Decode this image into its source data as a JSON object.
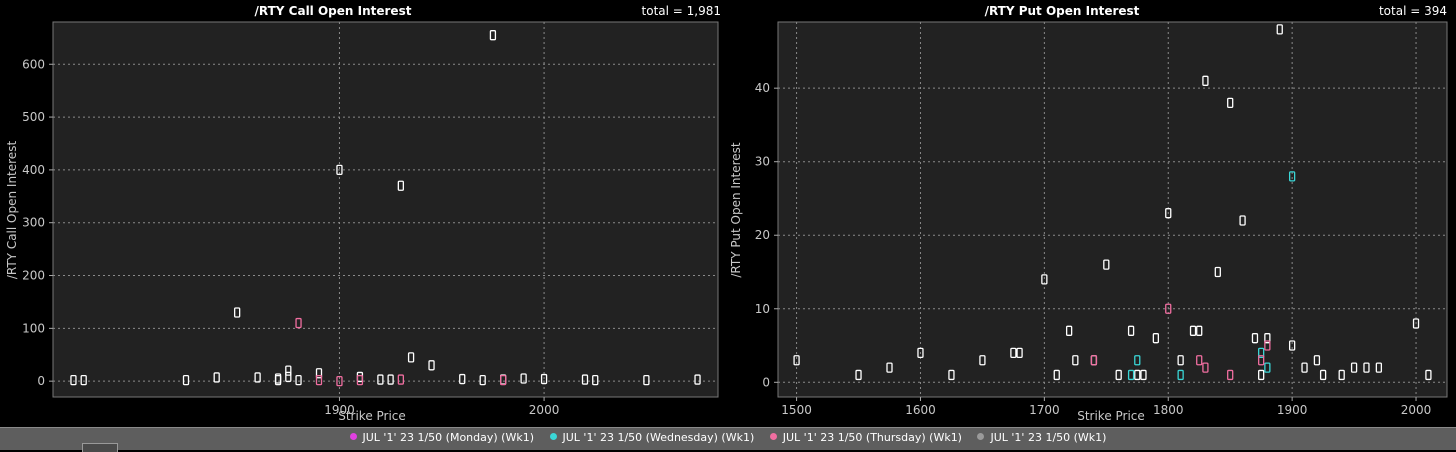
{
  "legend": [
    {
      "label": "JUL '1' 23 1/50 (Monday) (Wk1)",
      "color": "#e040e0"
    },
    {
      "label": "JUL '1' 23 1/50 (Wednesday) (Wk1)",
      "color": "#3ad6d6"
    },
    {
      "label": "JUL '1' 23 1/50 (Thursday) (Wk1)",
      "color": "#f06ea0"
    },
    {
      "label": "JUL '1' 23 1/50 (Wk1)",
      "color": "#9a9a9a"
    }
  ],
  "chart_data": [
    {
      "type": "scatter",
      "title": "/RTY Call Open Interest",
      "total_text": "total = 1,981",
      "xlabel": "Strike Price",
      "ylabel": "/RTY Call Open Interest",
      "xlim": [
        1760,
        2085
      ],
      "ylim": [
        -30,
        680
      ],
      "xticks": [
        1900,
        2000
      ],
      "yticks": [
        0,
        100,
        200,
        300,
        400,
        500,
        600
      ],
      "grid": true,
      "series": [
        {
          "color": "#ffffff",
          "points": [
            [
              1770,
              2
            ],
            [
              1775,
              2
            ],
            [
              1825,
              2
            ],
            [
              1840,
              7
            ],
            [
              1850,
              130
            ],
            [
              1860,
              7
            ],
            [
              1870,
              5
            ],
            [
              1870,
              2
            ],
            [
              1875,
              20
            ],
            [
              1875,
              8
            ],
            [
              1880,
              2
            ],
            [
              1890,
              15
            ],
            [
              1900,
              400
            ],
            [
              1910,
              8
            ],
            [
              1920,
              3
            ],
            [
              1925,
              3
            ],
            [
              1930,
              370
            ],
            [
              1935,
              45
            ],
            [
              1945,
              30
            ],
            [
              1960,
              4
            ],
            [
              1970,
              2
            ],
            [
              1975,
              655
            ],
            [
              1980,
              3
            ],
            [
              1990,
              5
            ],
            [
              2000,
              4
            ],
            [
              2020,
              3
            ],
            [
              2025,
              2
            ],
            [
              2050,
              2
            ],
            [
              2075,
              3
            ]
          ]
        },
        {
          "color": "#f06ea0",
          "points": [
            [
              1880,
              110
            ],
            [
              1890,
              2
            ],
            [
              1900,
              0
            ],
            [
              1910,
              2
            ],
            [
              1930,
              3
            ],
            [
              1980,
              2
            ]
          ]
        }
      ]
    },
    {
      "type": "scatter",
      "title": "/RTY Put Open Interest",
      "total_text": "total = 394",
      "xlabel": "Strike Price",
      "ylabel": "/RTY Put Open Interest",
      "xlim": [
        1485,
        2025
      ],
      "ylim": [
        -2,
        49
      ],
      "xticks": [
        1500,
        1600,
        1700,
        1800,
        1900,
        2000
      ],
      "yticks": [
        0,
        10,
        20,
        30,
        40
      ],
      "grid": true,
      "series": [
        {
          "color": "#ffffff",
          "points": [
            [
              1500,
              3
            ],
            [
              1550,
              1
            ],
            [
              1575,
              2
            ],
            [
              1600,
              4
            ],
            [
              1625,
              1
            ],
            [
              1650,
              3
            ],
            [
              1675,
              4
            ],
            [
              1680,
              4
            ],
            [
              1700,
              14
            ],
            [
              1710,
              1
            ],
            [
              1720,
              7
            ],
            [
              1725,
              3
            ],
            [
              1740,
              3
            ],
            [
              1750,
              16
            ],
            [
              1760,
              1
            ],
            [
              1770,
              7
            ],
            [
              1775,
              1
            ],
            [
              1780,
              1
            ],
            [
              1790,
              6
            ],
            [
              1800,
              23
            ],
            [
              1810,
              3
            ],
            [
              1820,
              7
            ],
            [
              1825,
              7
            ],
            [
              1830,
              41
            ],
            [
              1840,
              15
            ],
            [
              1850,
              38
            ],
            [
              1860,
              22
            ],
            [
              1870,
              6
            ],
            [
              1875,
              1
            ],
            [
              1880,
              6
            ],
            [
              1890,
              48
            ],
            [
              1900,
              5
            ],
            [
              1910,
              2
            ],
            [
              1920,
              3
            ],
            [
              1925,
              1
            ],
            [
              1940,
              1
            ],
            [
              1950,
              2
            ],
            [
              1960,
              2
            ],
            [
              1970,
              2
            ],
            [
              2000,
              8
            ],
            [
              2010,
              1
            ]
          ]
        },
        {
          "color": "#3ad6d6",
          "points": [
            [
              1770,
              1
            ],
            [
              1775,
              3
            ],
            [
              1810,
              1
            ],
            [
              1875,
              4
            ],
            [
              1880,
              2
            ],
            [
              1900,
              28
            ]
          ]
        },
        {
          "color": "#f06ea0",
          "points": [
            [
              1740,
              3
            ],
            [
              1800,
              10
            ],
            [
              1825,
              3
            ],
            [
              1830,
              2
            ],
            [
              1850,
              1
            ],
            [
              1875,
              3
            ],
            [
              1880,
              5
            ]
          ]
        }
      ]
    }
  ]
}
